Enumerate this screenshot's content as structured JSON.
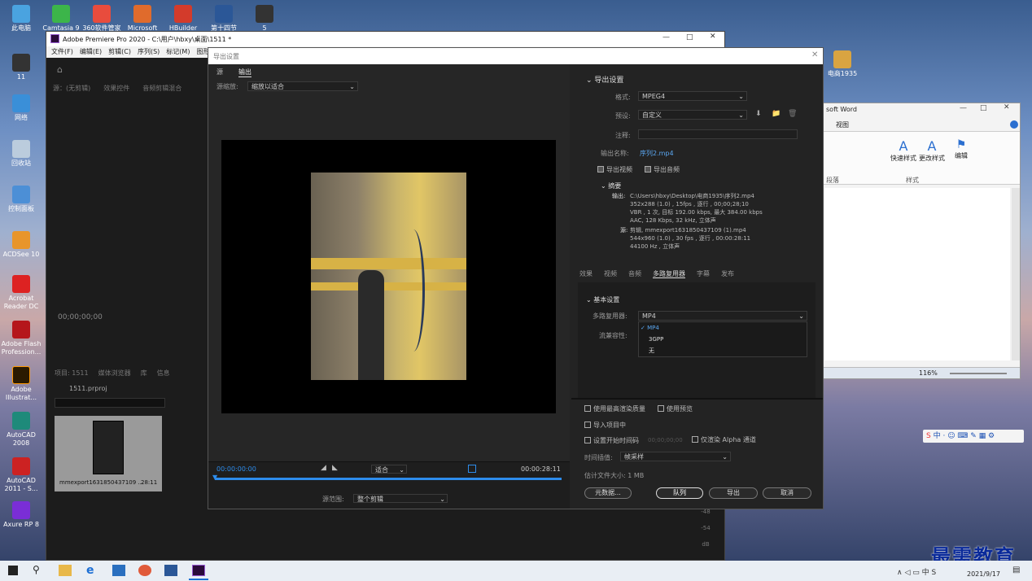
{
  "desktop": {
    "icons": [
      "此电脑",
      "Camtasia 9",
      "360软件管家",
      "Microsoft",
      "HBuilder",
      "第十四节",
      "5",
      "11",
      "网络",
      "回收站",
      "控制面板",
      "ACDSee 10",
      "Acrobat Reader DC",
      "Adobe Flash Profession...",
      "Adobe Illustrat...",
      "AutoCAD 2008",
      "AutoCAD 2011 - S...",
      "Axure RP 8",
      "电商1935",
      "最需教育"
    ]
  },
  "premiere": {
    "title": "Adobe Premiere Pro 2020 - C:\\用户\\hbxy\\桌面\\1511 *",
    "menu": [
      "文件(F)",
      "编辑(E)",
      "剪辑(C)",
      "序列(S)",
      "标记(M)",
      "图形"
    ],
    "panel_tabs": [
      "源：(无剪辑)",
      "效果控件",
      "音频剪辑混合"
    ],
    "timecode": "00;00;00;00",
    "project_tabs": [
      "项目: 1511",
      "媒体浏览器",
      "库",
      "信息"
    ],
    "project_name": "1511.prproj",
    "clip_name": "mmexport1631850437109 ...",
    "clip_duration": "28:11",
    "meter_labels": [
      "-48",
      "-54",
      "dB"
    ]
  },
  "word": {
    "title": "soft Word",
    "tab": "视图",
    "styles": [
      "快速样式",
      "更改样式",
      "编辑"
    ],
    "groups": [
      "段落",
      "样式"
    ],
    "zoom": "116%"
  },
  "dialog": {
    "title": "导出设置",
    "tabs": [
      "源",
      "输出"
    ],
    "source_zoom_label": "源缩放:",
    "source_zoom": "缩放以适合",
    "export_settings": {
      "header": "导出设置",
      "format_label": "格式:",
      "format": "MPEG4",
      "preset_label": "预设:",
      "preset": "自定义",
      "comment_label": "注释:",
      "output_name_label": "输出名称:",
      "output_name": "序列2.mp4",
      "export_video": "导出视频",
      "export_audio": "导出音频"
    },
    "summary": {
      "header": "摘要",
      "output_label": "输出:",
      "output_lines": [
        "C:\\Users\\hbxy\\Desktop\\电商1935\\序列2.mp4",
        "352x288 (1.0) , 15fps , 逐行 , 00;00;28;10",
        "VBR , 1 次, 目标 192.00 kbps, 最大 384.00 kbps",
        "AAC, 128 Kbps, 32 kHz, 立体声"
      ],
      "source_label": "源:",
      "source_lines": [
        "剪辑, mmexport1631850437109 (1).mp4",
        "544x960 (1.0) , 30 fps , 逐行 , 00:00:28:11",
        "44100 Hz , 立体声"
      ]
    },
    "settings_tabs": [
      "效果",
      "视频",
      "音频",
      "多路复用器",
      "字幕",
      "发布"
    ],
    "basic": {
      "header": "基本设置",
      "mux_label": "多路复用器:",
      "mux_value": "MP4",
      "stream_label": "流兼容性:",
      "options": [
        "MP4",
        "3GPP",
        "无"
      ]
    },
    "bottom": {
      "max_quality": "使用最高渲染质量",
      "use_preview": "使用预览",
      "import_project": "导入项目中",
      "set_start_tc": "设置开始时间码",
      "start_tc": "00;00;00;00",
      "alpha_only": "仅渲染 Alpha 通道",
      "interp_label": "时间插值:",
      "interp": "帧采样",
      "filesize": "估计文件大小: 1 MB",
      "metadata": "元数据...",
      "queue": "队列",
      "export": "导出",
      "cancel": "取消"
    },
    "preview": {
      "tc_start": "00:00:00:00",
      "fit": "适合",
      "tc_end": "00:00:28:11",
      "range_label": "源范围:",
      "range": "整个剪辑"
    }
  },
  "taskbar": {
    "date": "2021/9/17",
    "watermark": "最需教育",
    "ime": "中"
  },
  "colors": {
    "dialog_bg": "#232323",
    "accent": "#2d8ceb",
    "text_blue": "#5aa6f0"
  }
}
